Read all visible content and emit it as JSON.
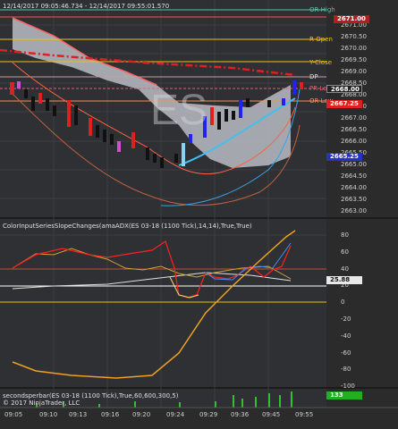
{
  "header": {
    "time_range": "12/14/2017 09:05:46.734 - 12/14/2017 09:55:01.570"
  },
  "levels": {
    "or_high": "OR-High",
    "r_open": "R-Open",
    "y_close": "Y-Close",
    "dp": "DP",
    "pr_low": "PR-Low",
    "or_low": "OR-Low",
    "price_tag_top": "2671.00",
    "price_tag_gray": "2668.00",
    "price_tag_red": "2667.25",
    "price_tag_blue": "2665.25"
  },
  "watermark": "ES",
  "price_axis": [
    "2671.00",
    "2670.50",
    "2670.00",
    "2669.50",
    "2669.00",
    "2668.50",
    "2668.00",
    "2667.50",
    "2667.00",
    "2666.50",
    "2666.00",
    "2665.50",
    "2665.00",
    "2664.50",
    "2664.00",
    "2663.50",
    "2663.00"
  ],
  "indicator1": {
    "title": "ColorInputSeriesSlopeChanges(amaADX(ES 03-18 (1100 Tick),14,14),True,True)",
    "axis": [
      "80",
      "60",
      "40",
      "20",
      "0",
      "-20",
      "-40",
      "-60",
      "-80",
      "-100"
    ],
    "value_tag": "25.88"
  },
  "indicator2": {
    "title": "secondsperbar(ES 03-18 (1100 Tick),True,60,600,300,5)",
    "copyright": "© 2017 NinjaTrader, LLC",
    "value_tag": "133"
  },
  "time_axis": [
    "09:05",
    "09:10",
    "09:13",
    "09:16",
    "09:20",
    "09:24",
    "09:29",
    "09:36",
    "09:45",
    "09:55"
  ],
  "colors": {
    "up": "#2222ee",
    "down": "#e02020",
    "neutral": "#d050d0",
    "accent_orange": "#f0a020"
  }
}
